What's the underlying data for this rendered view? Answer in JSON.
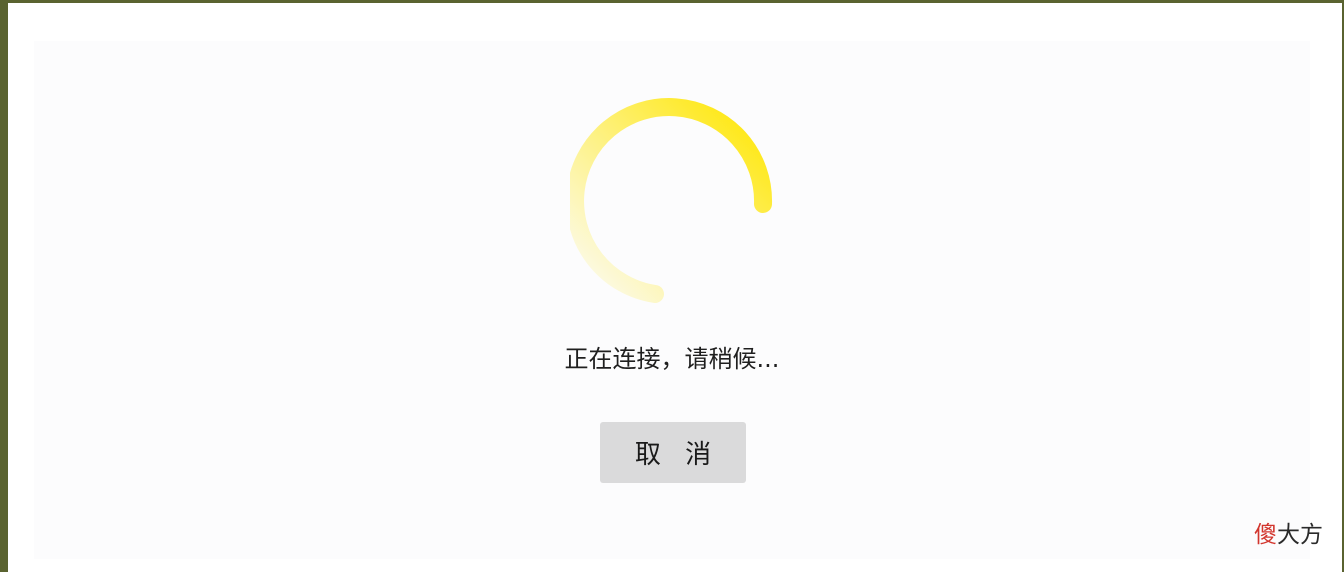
{
  "dialog": {
    "status_text": "正在连接，请稍候...",
    "cancel_label": "取 消"
  },
  "spinner": {
    "icon": "loading-spinner-icon",
    "accent_color": "#FFE500"
  },
  "watermark": {
    "red_part": "傻",
    "dark_part": "大方"
  }
}
